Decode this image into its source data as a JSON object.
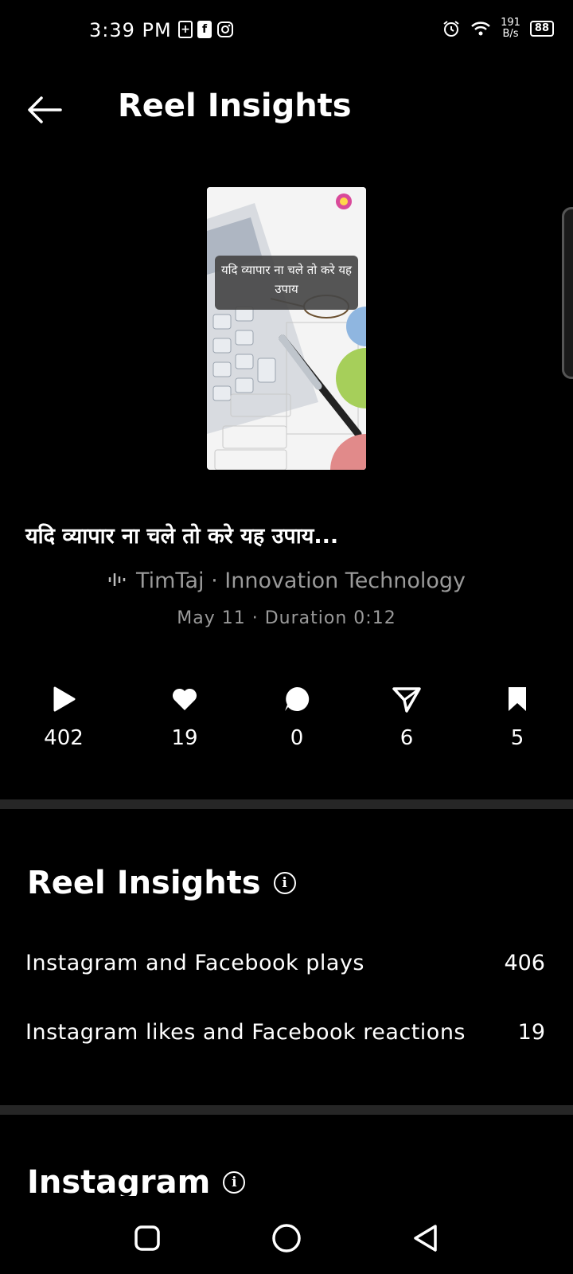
{
  "status": {
    "time": "3:39 PM",
    "netspeed_top": "191",
    "netspeed_bottom": "B/s",
    "battery": "88"
  },
  "header": {
    "title": "Reel Insights"
  },
  "reel": {
    "thumbnail_caption": "यदि व्यापार ना चले तो करे यह उपाय",
    "title": "यदि व्यापार ना चले तो करे यह उपाय...",
    "audio": "TimTaj · Innovation Technology",
    "date_duration": "May 11 · Duration 0:12"
  },
  "stats": {
    "plays": "402",
    "likes": "19",
    "comments": "0",
    "shares": "6",
    "saves": "5"
  },
  "insights": {
    "section_title": "Reel Insights",
    "rows": [
      {
        "label": "Instagram and Facebook plays",
        "value": "406"
      },
      {
        "label": "Instagram likes and Facebook reactions",
        "value": "19"
      }
    ]
  },
  "instagram_section": {
    "title": "Instagram"
  }
}
